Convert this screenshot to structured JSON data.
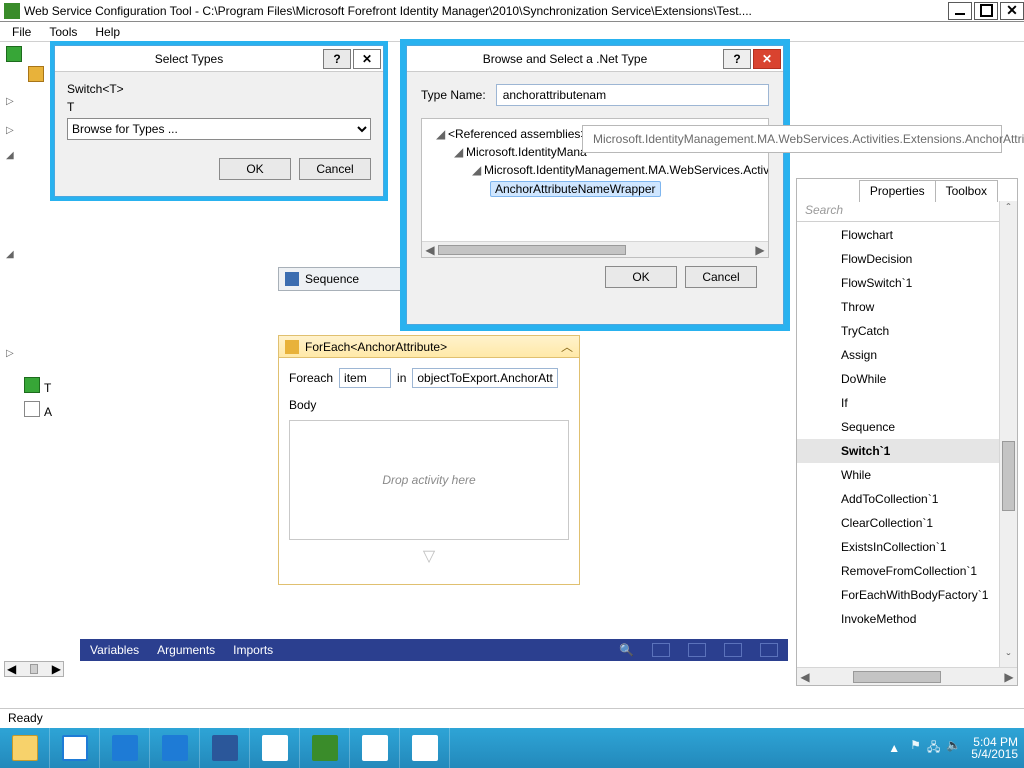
{
  "window": {
    "title": "Web Service Configuration Tool - C:\\Program Files\\Microsoft Forefront Identity Manager\\2010\\Synchronization Service\\Extensions\\Test...."
  },
  "menu": {
    "file": "File",
    "tools": "Tools",
    "help": "Help"
  },
  "left_tree": {
    "item_t": "T",
    "item_a": "A"
  },
  "sequence": {
    "label": "Sequence"
  },
  "foreach": {
    "header": "ForEach<AnchorAttribute>",
    "label_foreach": "Foreach",
    "item_value": "item",
    "label_in": "in",
    "expr_value": "objectToExport.AnchorAtt",
    "label_body": "Body",
    "drop_hint": "Drop activity here"
  },
  "varbar": {
    "variables": "Variables",
    "arguments": "Arguments",
    "imports": "Imports"
  },
  "select_types": {
    "title": "Select Types",
    "line1": "Switch<T>",
    "line2": "T",
    "combo": "Browse for Types ...",
    "ok": "OK",
    "cancel": "Cancel"
  },
  "browse_type": {
    "title": "Browse and Select a .Net Type",
    "label_typename": "Type Name:",
    "typename_value": "anchorattributenam",
    "node_root": "<Referenced assemblies>",
    "node_asm": "Microsoft.IdentityMana",
    "node_ns": "Microsoft.IdentityManagement.MA.WebServices.Activit",
    "node_type": "AnchorAttributeNameWrapper",
    "ok": "OK",
    "cancel": "Cancel"
  },
  "tooltip": "Microsoft.IdentityManagement.MA.WebServices.Activities.Extensions.AnchorAttributeNameWrapper",
  "rpanel": {
    "tab_properties": "Properties",
    "tab_toolbox": "Toolbox",
    "search_placeholder": "Search",
    "items": [
      "Flowchart",
      "FlowDecision",
      "FlowSwitch`1",
      "Throw",
      "TryCatch",
      "Assign",
      "DoWhile",
      "If",
      "Sequence",
      "Switch`1",
      "While",
      "AddToCollection`1",
      "ClearCollection`1",
      "ExistsInCollection`1",
      "RemoveFromCollection`1",
      "ForEachWithBodyFactory`1",
      "InvokeMethod"
    ],
    "selected_index": 9
  },
  "status": {
    "text": "Ready"
  },
  "taskbar": {
    "time": "5:04 PM",
    "date": "5/4/2015"
  },
  "glyph": {
    "help": "?",
    "close": "✕",
    "chev_up": "︿",
    "chev_down": "﹀",
    "tri_up": "▲",
    "tri_down": "▽",
    "tri_left": "◀",
    "tri_right": "▶",
    "search": "🔍",
    "flag": "⚑",
    "net": "🖧",
    "vol": "🔈",
    "expand": "▷",
    "collapse": "◢"
  }
}
